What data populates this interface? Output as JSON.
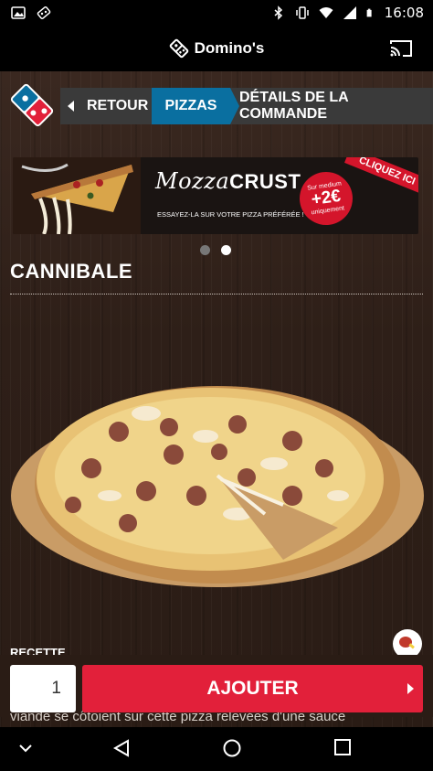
{
  "status_bar": {
    "time": "16:08",
    "icons": [
      "image-icon",
      "dominos-notification-icon",
      "bluetooth-icon",
      "vibrate-icon",
      "wifi-icon",
      "cellular-icon",
      "battery-icon"
    ]
  },
  "app_bar": {
    "title": "Domino's",
    "icons": [
      "dominos-logo-icon",
      "cast-icon"
    ]
  },
  "breadcrumb": {
    "back_label": "RETOUR",
    "active_label": "PIZZAS",
    "next_label": "DÉTAILS DE LA COMMANDE"
  },
  "banner": {
    "brand_script": "Mozza",
    "brand_bold": "CRUST",
    "tagline": "ESSAYEZ-LA SUR VOTRE PIZZA PRÉFÉRÉE !",
    "badge_top": "Sur medium",
    "badge_price": "+2€",
    "badge_bottom": "uniquement",
    "ribbon": "CLIQUEZ ICI"
  },
  "carousel": {
    "count": 2,
    "active_index": 1
  },
  "product": {
    "name": "CANNIBALE",
    "section_label": "RECETTE",
    "description_partial": "viande se côtoient sur cette pizza relevées d'une sauce"
  },
  "order": {
    "quantity": "1",
    "add_label": "AJOUTER"
  },
  "colors": {
    "accent_red": "#e2203a",
    "active_blue": "#0a6fa0",
    "crumb_gray": "#3a3a3a"
  },
  "nav_bar": {
    "icons": [
      "chevron-down-icon",
      "back-triangle-icon",
      "home-circle-icon",
      "recents-square-icon"
    ]
  }
}
